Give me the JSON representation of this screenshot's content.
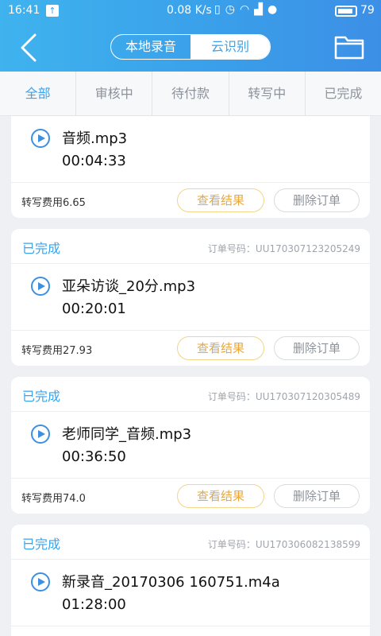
{
  "status_bar": {
    "time": "16:41",
    "network_speed": "0.08 K/s",
    "icons": [
      "vibrate-icon",
      "alarm-icon",
      "wifi-icon",
      "signal-icon",
      "hd-icon"
    ],
    "battery": "79"
  },
  "header": {
    "tabs": [
      {
        "label": "本地录音",
        "active": false
      },
      {
        "label": "云识别",
        "active": true
      }
    ]
  },
  "filter_tabs": [
    {
      "label": "全部",
      "active": true
    },
    {
      "label": "审核中",
      "active": false
    },
    {
      "label": "待付款",
      "active": false
    },
    {
      "label": "转写中",
      "active": false
    },
    {
      "label": "已完成",
      "active": false
    }
  ],
  "cards": [
    {
      "status": "",
      "order": "",
      "filename": "音频.mp3",
      "duration": "00:04:33",
      "fee": "转写费用6.65",
      "result_label": "查看结果",
      "delete_label": "删除订单"
    },
    {
      "status": "已完成",
      "order": "订单号码：UU170307123205249",
      "filename": "亚朵访谈_20分.mp3",
      "duration": "00:20:01",
      "fee": "转写费用27.93",
      "result_label": "查看结果",
      "delete_label": "删除订单"
    },
    {
      "status": "已完成",
      "order": "订单号码：UU170307120305489",
      "filename": "老师同学_音频.mp3",
      "duration": "00:36:50",
      "fee": "转写费用74.0",
      "result_label": "查看结果",
      "delete_label": "删除订单"
    },
    {
      "status": "已完成",
      "order": "订单号码：UU170306082138599",
      "filename": "新录音_20170306 160751.m4a",
      "duration": "01:28:00",
      "fee": "",
      "result_label": "",
      "delete_label": ""
    }
  ],
  "colors": {
    "accent": "#3aa3ea",
    "result_button": "#eaa83a",
    "background": "#eef0f4"
  }
}
